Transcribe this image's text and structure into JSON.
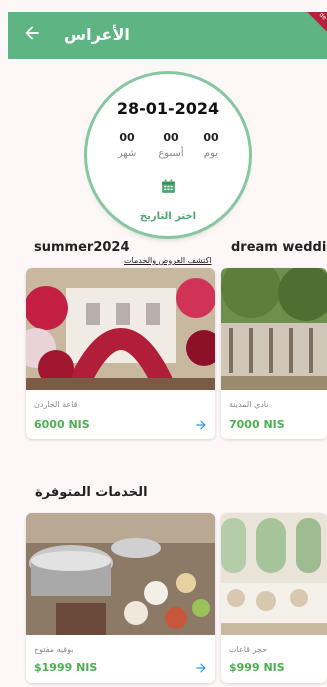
{
  "appbar": {
    "title": "الأعراس",
    "ribbon": "de"
  },
  "date_card": {
    "date": "28-01-2024",
    "counters": [
      {
        "value": "00",
        "label": "يوم"
      },
      {
        "value": "00",
        "label": "أسبوع"
      },
      {
        "value": "00",
        "label": "شهر"
      }
    ],
    "pick_label": "اختر التاريخ"
  },
  "offers": {
    "title_left": "summer2024",
    "title_right": "dream weddi",
    "discover": "اكتشف العروض والخدمات",
    "cards": [
      {
        "name": "قاعة الجاردن",
        "price": "6000 NIS"
      },
      {
        "name": "نادي المدينة",
        "price": "7000 NIS"
      }
    ]
  },
  "services": {
    "title": "الخدمات المتوفرة",
    "cards": [
      {
        "name": "بوفيه مفتوح",
        "price": "$1999 NIS"
      },
      {
        "name": "حجز قاعات",
        "price": "$999 NIS"
      }
    ]
  },
  "colors": {
    "primary": "#5fb483",
    "price": "#4caf50",
    "arrow": "#2196f3"
  }
}
